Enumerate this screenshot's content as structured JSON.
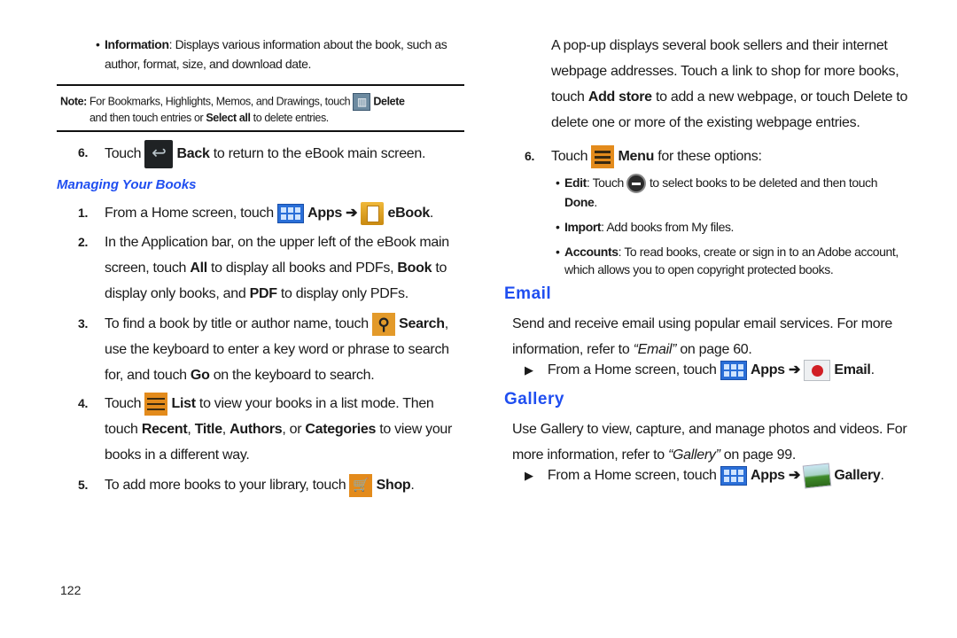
{
  "left": {
    "info_bullet": {
      "term": "Information",
      "text": ": Displays various information about the book, such as",
      "text2": "author, format, size, and download date."
    },
    "note": {
      "label": "Note:",
      "line1_a": "For Bookmarks, Highlights, Memos, and Drawings, touch",
      "line1_icon": "delete-icon",
      "line1_b": "Delete",
      "line2_a": "and then touch entries or",
      "line2_b": "Select all",
      "line2_c": "to delete entries."
    },
    "step6": {
      "num": "6.",
      "a": "Touch",
      "icon": "back-icon",
      "b": "Back",
      "c": "to return to the eBook main screen."
    },
    "heading": "Managing Your Books",
    "steps": [
      {
        "num": "1.",
        "a": "From a Home screen, touch",
        "b": "Apps",
        "arrow": "➔",
        "c": "eBook",
        "d": "."
      },
      {
        "num": "2.",
        "l1a": "In the Application bar, on the upper left of the eBook main",
        "l2a": "screen, touch",
        "l2b": "All",
        "l2c": "to display all books and PDFs,",
        "l2d": "Book",
        "l2e": "to",
        "l3a": "display only books, and",
        "l3b": "PDF",
        "l3c": "to display only PDFs."
      },
      {
        "num": "3.",
        "l1a": "To find a book by title or author name, touch",
        "l1b": "Search",
        "l1c": ",",
        "l2": "use the keyboard to enter a key word or phrase to search",
        "l3a": "for, and touch",
        "l3b": "Go",
        "l3c": "on the keyboard to search."
      },
      {
        "num": "4.",
        "l1a": "Touch",
        "l1b": "List",
        "l1c": "to view your books in a list mode. Then",
        "l2a": "touch",
        "l2b": "Recent",
        "l2c": ",",
        "l2d": "Title",
        "l2e": ",",
        "l2f": "Authors",
        "l2g": ", or",
        "l2h": "Categories",
        "l2i": "to view your",
        "l3": "books in a different way."
      },
      {
        "num": "5.",
        "a": "To add more books to your library, touch",
        "b": "Shop",
        "c": "."
      }
    ],
    "page_number": "122"
  },
  "right": {
    "popup_para": [
      "A pop-up displays several book sellers and their internet",
      "webpage addresses. Touch a link to shop for more books,"
    ],
    "popup_l3": {
      "a": "touch",
      "b": "Add store",
      "c": "to add a new webpage, or touch Delete to"
    },
    "popup_l4": "delete one or more of the existing webpage entries.",
    "step6": {
      "num": "6.",
      "a": "Touch",
      "b": "Menu",
      "c": "for these options:"
    },
    "bullets": {
      "edit": {
        "term": "Edit",
        "a": ": Touch",
        "b": "to select books to be deleted and then touch",
        "c": "Done",
        "d": "."
      },
      "import": {
        "term": "Import",
        "a": ": Add books from My files."
      },
      "accounts": {
        "term": "Accounts",
        "a": ": To read books, create or sign in to an Adobe account,",
        "b": "which allows you to open copyright protected books."
      }
    },
    "email": {
      "heading": "Email",
      "l1": "Send and receive email using popular email services. For more",
      "l2a": "information, refer to",
      "l2b": "“Email”",
      "l2c": "on page 60.",
      "step": {
        "marker": "▶",
        "a": "From a Home screen, touch",
        "b": "Apps",
        "arrow": "➔",
        "c": "Email",
        "d": "."
      }
    },
    "gallery": {
      "heading": "Gallery",
      "l1": "Use Gallery to view, capture, and manage photos and videos. For",
      "l2a": "more information, refer to",
      "l2b": "“Gallery”",
      "l2c": "on page 99.",
      "step": {
        "marker": "▶",
        "a": "From a Home screen, touch",
        "b": "Apps",
        "arrow": "➔",
        "c": "Gallery",
        "d": "."
      }
    }
  }
}
